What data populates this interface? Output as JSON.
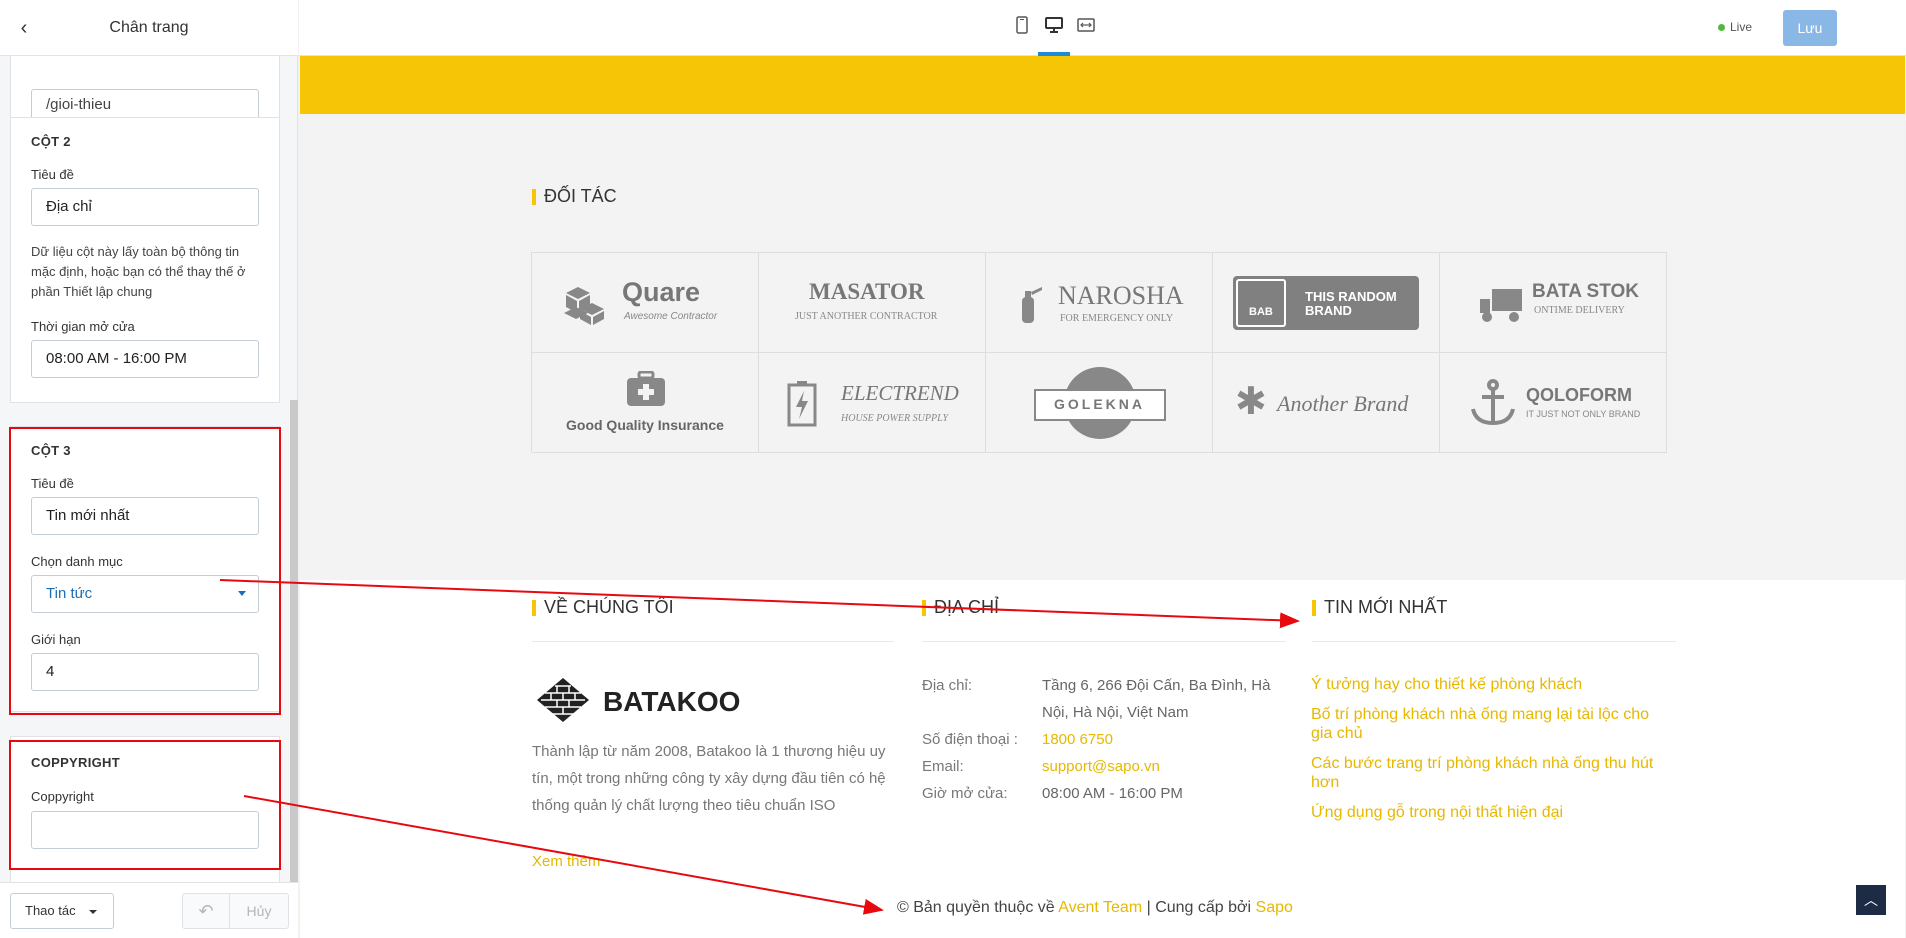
{
  "sidebar": {
    "title": "Chân trang",
    "col1_value_partial": "/gioi-thieu",
    "col2": {
      "heading": "CỘT 2",
      "title_label": "Tiêu đề",
      "title_value": "Địa chỉ",
      "help": "Dữ liệu cột này lấy toàn bộ thông tin mặc định, hoặc bạn có thể thay thế ở phần Thiết lập chung",
      "hours_label": "Thời gian mở cửa",
      "hours_value": "08:00 AM - 16:00 PM"
    },
    "col3": {
      "heading": "CỘT 3",
      "title_label": "Tiêu đề",
      "title_value": "Tin mới nhất",
      "category_label": "Chọn danh mục",
      "category_value": "Tin tức",
      "limit_label": "Giới hạn",
      "limit_value": "4"
    },
    "copyright": {
      "heading": "COPPYRIGHT",
      "label": "Coppyright",
      "value": ""
    },
    "footer": {
      "actions_label": "Thao tác",
      "cancel_label": "Hủy"
    }
  },
  "topbar": {
    "live_label": "Live",
    "save_label": "Lưu"
  },
  "preview": {
    "partners_title": "ĐỐI TÁC",
    "partners": [
      {
        "name": "Quare",
        "sub": "Awesome Contractor"
      },
      {
        "name": "MASATOR",
        "sub": "JUST ANOTHER CONTRACTOR"
      },
      {
        "name": "NAROSHA",
        "sub": "FOR EMERGENCY ONLY"
      },
      {
        "name": "THIS RANDOM BRAND",
        "sub": "BAB"
      },
      {
        "name": "BATA STOK",
        "sub": "ONTIME DELIVERY"
      },
      {
        "name": "Good Quality Insurance",
        "sub": ""
      },
      {
        "name": "ELECTREND",
        "sub": "HOUSE POWER SUPPLY"
      },
      {
        "name": "GOLEKNA",
        "sub": ""
      },
      {
        "name": "Another Brand",
        "sub": ""
      },
      {
        "name": "QOLOFORM",
        "sub": "IT JUST NOT ONLY BRAND"
      }
    ],
    "about": {
      "title": "VỀ CHÚNG TÔI",
      "brand": "BATAKOO",
      "text": "Thành lập từ năm 2008, Batakoo là 1 thương hiệu uy tín, một trong những công ty xây dựng đầu tiên có hệ thống quản lý chất lượng theo tiêu chuẩn ISO",
      "more": "Xem thêm"
    },
    "address": {
      "title": "ĐỊA CHỈ",
      "addr_label": "Địa chỉ:",
      "addr_value": "Tầng 6, 266 Đội Cấn, Ba Đình, Hà Nội, Hà Nội, Việt Nam",
      "phone_label": "Số điện thoại :",
      "phone_value": "1800 6750",
      "email_label": "Email:",
      "email_value": "support@sapo.vn",
      "hours_label": "Giờ mở cửa:",
      "hours_value": "08:00 AM - 16:00 PM"
    },
    "news": {
      "title": "TIN MỚI NHẤT",
      "items": [
        "Ý tưởng hay cho thiết kế phòng khách",
        "Bố trí phòng khách nhà ống mang lại tài lộc cho gia chủ",
        "Các bước trang trí phòng khách nhà ống thu hút hơn",
        "Ứng dụng gỗ trong nội thất hiện đại"
      ]
    },
    "copyright": {
      "prefix": "© Bản quyền thuộc về",
      "owner": "Avent Team",
      "sep": "| Cung cấp bởi",
      "provider": "Sapo"
    }
  }
}
